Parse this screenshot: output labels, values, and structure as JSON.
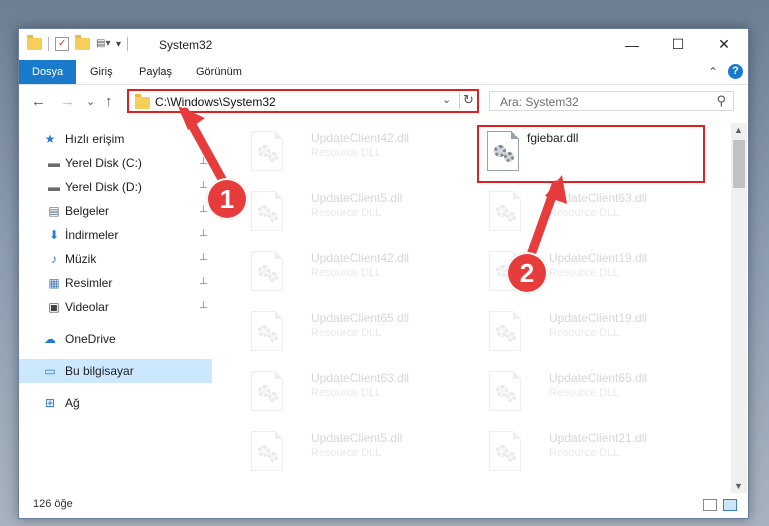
{
  "window": {
    "title": "System32",
    "controls": {
      "minimize": "—",
      "maximize": "☐",
      "close": "✕"
    }
  },
  "ribbon": {
    "tabs": [
      {
        "label": "Dosya",
        "active": true
      },
      {
        "label": "Giriş"
      },
      {
        "label": "Paylaş"
      },
      {
        "label": "Görünüm"
      }
    ],
    "collapse": "⌃",
    "help": "?"
  },
  "navbar": {
    "back": "←",
    "forward": "→",
    "recent": "⌄",
    "up": "↑",
    "address": "C:\\Windows\\System32",
    "dropdown": "⌄",
    "refresh": "↻",
    "search_placeholder": "Ara: System32",
    "search_icon": "⚲"
  },
  "sidebar": {
    "items": [
      {
        "label": "Hızlı erişim",
        "icon": "star-icon",
        "glyph": "★",
        "color": "#2b79d6",
        "pinned": false
      },
      {
        "label": "Yerel Disk (C:)",
        "icon": "drive-icon",
        "glyph": "▬",
        "color": "#6b6b6b",
        "pinned": true
      },
      {
        "label": "Yerel Disk (D:)",
        "icon": "drive-icon",
        "glyph": "▬",
        "color": "#6b6b6b",
        "pinned": true
      },
      {
        "label": "Belgeler",
        "icon": "documents-icon",
        "glyph": "▤",
        "color": "#5a6d82",
        "pinned": true
      },
      {
        "label": "İndirmeler",
        "icon": "download-icon",
        "glyph": "⬇",
        "color": "#2b79d6",
        "pinned": true
      },
      {
        "label": "Müzik",
        "icon": "music-icon",
        "glyph": "♪",
        "color": "#2b79d6",
        "pinned": true
      },
      {
        "label": "Resimler",
        "icon": "pictures-icon",
        "glyph": "▦",
        "color": "#4a7fb5",
        "pinned": true
      },
      {
        "label": "Videolar",
        "icon": "videos-icon",
        "glyph": "▣",
        "color": "#444",
        "pinned": true
      },
      {
        "label": "OneDrive",
        "icon": "cloud-icon",
        "glyph": "☁",
        "color": "#2b79d6",
        "pinned": false
      },
      {
        "label": "Bu bilgisayar",
        "icon": "computer-icon",
        "glyph": "▭",
        "color": "#2b79d6",
        "pinned": false,
        "selected": true
      },
      {
        "label": "Ağ",
        "icon": "network-icon",
        "glyph": "⊞",
        "color": "#2b79d6",
        "pinned": false
      }
    ],
    "pin_glyph": "📌"
  },
  "files": [
    {
      "name": "UpdateClient42.dll",
      "type": "Resource DLL",
      "faded": true
    },
    {
      "name": "fgiebar.dll",
      "type": "",
      "faded": false,
      "highlight": true
    },
    {
      "name": "UpdateClient5.dll",
      "type": "Resource DLL",
      "faded": true
    },
    {
      "name": "UpdateClient63.dll",
      "type": "Resource DLL",
      "faded": true
    },
    {
      "name": "UpdateClient42.dll",
      "type": "Resource DLL",
      "faded": true
    },
    {
      "name": "UpdateClient19.dll",
      "type": "Resource DLL",
      "faded": true
    },
    {
      "name": "UpdateClient65.dll",
      "type": "Resource DLL",
      "faded": true
    },
    {
      "name": "UpdateClient19.dll",
      "type": "Resource DLL",
      "faded": true
    },
    {
      "name": "UpdateClient63.dll",
      "type": "Resource DLL",
      "faded": true
    },
    {
      "name": "UpdateClient65.dll",
      "type": "Resource DLL",
      "faded": true
    },
    {
      "name": "UpdateClient5.dll",
      "type": "Resource DLL",
      "faded": true
    },
    {
      "name": "UpdateClient21.dll",
      "type": "Resource DLL",
      "faded": true
    }
  ],
  "status": {
    "count": "126 öğe"
  },
  "annotations": {
    "step1": "1",
    "step2": "2",
    "color": "#e73c3c"
  }
}
